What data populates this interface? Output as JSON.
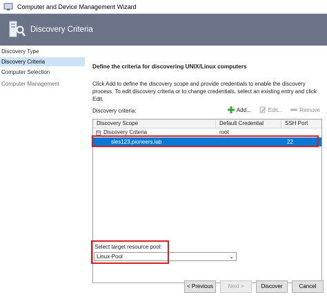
{
  "window": {
    "title": "Computer and Device Management Wizard"
  },
  "header": {
    "title": "Discovery Criteria"
  },
  "sidebar": {
    "items": [
      {
        "label": "Discovery Type"
      },
      {
        "label": "Discovery Criteria"
      },
      {
        "label": "Computer Selection"
      },
      {
        "label": "Computer Management"
      }
    ]
  },
  "main": {
    "heading": "Define the criteria for discovering UNIX/Linux computers",
    "description": "Click Add to define the discovery scope and provide credentials to enable the discovery process. To edit discovery criteria or to change credentials, select an existing entry and click Edit.",
    "criteria_label": "Discovery criteria:",
    "toolbar": {
      "add": "Add...",
      "edit": "Edit...",
      "remove": "Remove"
    },
    "grid": {
      "columns": [
        "Discovery Scope",
        "Default Credential",
        "SSH Port"
      ],
      "group": {
        "expander": "⊟",
        "label": "Discovery Criteria",
        "credential": "root"
      },
      "rows": [
        {
          "scope": "sles123.pioneers.lab",
          "credential": "",
          "port": "22"
        }
      ]
    },
    "pool_label": "Select target resource pool:",
    "pool_value": "Linux-Pool"
  },
  "footer": {
    "previous": "< Previous",
    "next": "Next >",
    "discover": "Discover",
    "cancel": "Cancel"
  },
  "colors": {
    "header_bg": "#6b7388",
    "selection": "#0a78d7",
    "highlight_box": "#d81e1e",
    "add_icon": "#3aa63a"
  }
}
